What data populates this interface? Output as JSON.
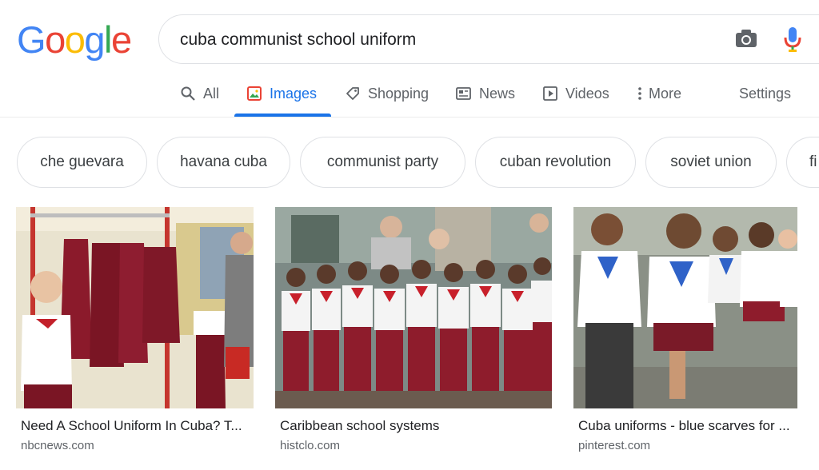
{
  "logo": {
    "letters": [
      "G",
      "o",
      "o",
      "g",
      "l",
      "e"
    ],
    "colors": [
      "#4285F4",
      "#EA4335",
      "#FBBC05",
      "#4285F4",
      "#34A853",
      "#EA4335"
    ]
  },
  "search": {
    "query": "cuba communist school uniform",
    "camera_icon": "camera-icon",
    "mic_icon": "microphone-icon"
  },
  "tabs": [
    {
      "label": "All",
      "icon": "search-icon",
      "active": false
    },
    {
      "label": "Images",
      "icon": "image-icon",
      "active": true
    },
    {
      "label": "Shopping",
      "icon": "tag-icon",
      "active": false
    },
    {
      "label": "News",
      "icon": "news-icon",
      "active": false
    },
    {
      "label": "Videos",
      "icon": "play-icon",
      "active": false
    },
    {
      "label": "More",
      "icon": "more-vert-icon",
      "active": false
    },
    {
      "label": "Settings",
      "active": false
    }
  ],
  "chips": [
    "che guevara",
    "havana cuba",
    "communist party",
    "cuban revolution",
    "soviet union",
    "fi"
  ],
  "results": [
    {
      "title": "Need A School Uniform In Cuba? T...",
      "source": "nbcnews.com"
    },
    {
      "title": "Caribbean school systems",
      "source": "histclo.com"
    },
    {
      "title": "Cuba uniforms - blue scarves for ...",
      "source": "pinterest.com"
    }
  ],
  "colors": {
    "accent": "#1a73e8",
    "muted": "#5f6368",
    "border": "#dfe1e5"
  }
}
